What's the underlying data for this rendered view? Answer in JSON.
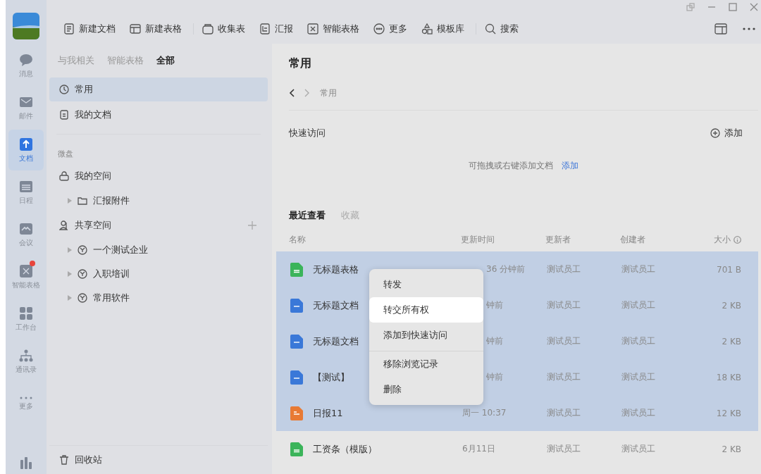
{
  "rail": {
    "items": [
      {
        "label": "消息",
        "kind": "chat",
        "selected": false,
        "badge": false
      },
      {
        "label": "邮件",
        "kind": "mail",
        "selected": false,
        "badge": false
      },
      {
        "label": "文档",
        "kind": "doc",
        "selected": true,
        "badge": false
      },
      {
        "label": "日程",
        "kind": "calendar",
        "selected": false,
        "badge": false
      },
      {
        "label": "会议",
        "kind": "meeting",
        "selected": false,
        "badge": false
      },
      {
        "label": "智能表格",
        "kind": "smart",
        "selected": false,
        "badge": true
      },
      {
        "label": "工作台",
        "kind": "apps",
        "selected": false,
        "badge": false
      },
      {
        "label": "通讯录",
        "kind": "contacts",
        "selected": false,
        "badge": false
      },
      {
        "label": "更多",
        "kind": "more",
        "selected": false,
        "badge": false
      }
    ]
  },
  "toolbar": {
    "items": [
      {
        "label": "新建文档",
        "kind": "doc"
      },
      {
        "label": "新建表格",
        "kind": "table"
      },
      {
        "label": "收集表",
        "kind": "collect"
      },
      {
        "label": "汇报",
        "kind": "report"
      },
      {
        "label": "智能表格",
        "kind": "smart"
      },
      {
        "label": "更多",
        "kind": "more"
      },
      {
        "label": "模板库",
        "kind": "template"
      },
      {
        "label": "搜索",
        "kind": "search"
      }
    ]
  },
  "sidebar": {
    "tabs": [
      {
        "label": "与我相关",
        "selected": false
      },
      {
        "label": "智能表格",
        "selected": false
      },
      {
        "label": "全部",
        "selected": true
      }
    ],
    "nav": [
      {
        "label": "常用",
        "kind": "clock",
        "selected": true
      },
      {
        "label": "我的文档",
        "kind": "doc",
        "selected": false
      }
    ],
    "section": "微盘",
    "spaces": [
      {
        "label": "我的空间",
        "kind": "lock",
        "can_add": false,
        "children": [
          {
            "label": "汇报附件",
            "kind": "folder"
          }
        ]
      },
      {
        "label": "共享空间",
        "kind": "people",
        "can_add": true,
        "children": [
          {
            "label": "一个测试企业",
            "kind": "org"
          },
          {
            "label": "入职培训",
            "kind": "org"
          },
          {
            "label": "常用软件",
            "kind": "org"
          }
        ]
      }
    ],
    "recycle": "回收站"
  },
  "content": {
    "title": "常用",
    "breadcrumb": "常用",
    "quick_access": {
      "title": "快速访问",
      "add_button": "添加",
      "empty_text": "可拖拽或右键添加文档",
      "empty_link": "添加"
    },
    "recent_tabs": [
      {
        "label": "最近查看",
        "selected": true
      },
      {
        "label": "收藏",
        "selected": false
      }
    ],
    "columns": [
      "名称",
      "更新时间",
      "更新者",
      "创建者",
      "大小"
    ],
    "rows": [
      {
        "name": "无标题表格",
        "kind": "sheet",
        "updated": "36 分钟前",
        "updater": "测试员工",
        "creator": "测试员工",
        "size": "701 B",
        "selected": true,
        "under_menu": true
      },
      {
        "name": "无标题文档",
        "kind": "doc",
        "updated": "钟前",
        "updater": "测试员工",
        "creator": "测试员工",
        "size": "2 KB",
        "selected": true,
        "under_menu": true
      },
      {
        "name": "无标题文档",
        "kind": "doc",
        "updated": "钟前",
        "updater": "测试员工",
        "creator": "测试员工",
        "size": "2 KB",
        "selected": true,
        "under_menu": true
      },
      {
        "name": "【测试】",
        "kind": "doc",
        "updated": "钟前",
        "updater": "测试员工",
        "creator": "测试员工",
        "size": "18 KB",
        "selected": true,
        "under_menu": true
      },
      {
        "name": "日报11",
        "kind": "report",
        "updated": "周一 10:37",
        "updater": "测试员工",
        "creator": "测试员工",
        "size": "12 KB",
        "selected": true,
        "under_menu": false
      },
      {
        "name": "工资条（模版）",
        "kind": "sheet",
        "updated": "6月11日",
        "updater": "测试员工",
        "creator": "测试员工",
        "size": "2 KB",
        "selected": false,
        "under_menu": false
      }
    ],
    "context_menu": [
      {
        "label": "转发",
        "highlighted": false,
        "divider_before": false
      },
      {
        "label": "转交所有权",
        "highlighted": true,
        "divider_before": false
      },
      {
        "label": "添加到快速访问",
        "highlighted": false,
        "divider_before": false
      },
      {
        "label": "移除浏览记录",
        "highlighted": false,
        "divider_before": true
      },
      {
        "label": "删除",
        "highlighted": false,
        "divider_before": false
      }
    ]
  }
}
